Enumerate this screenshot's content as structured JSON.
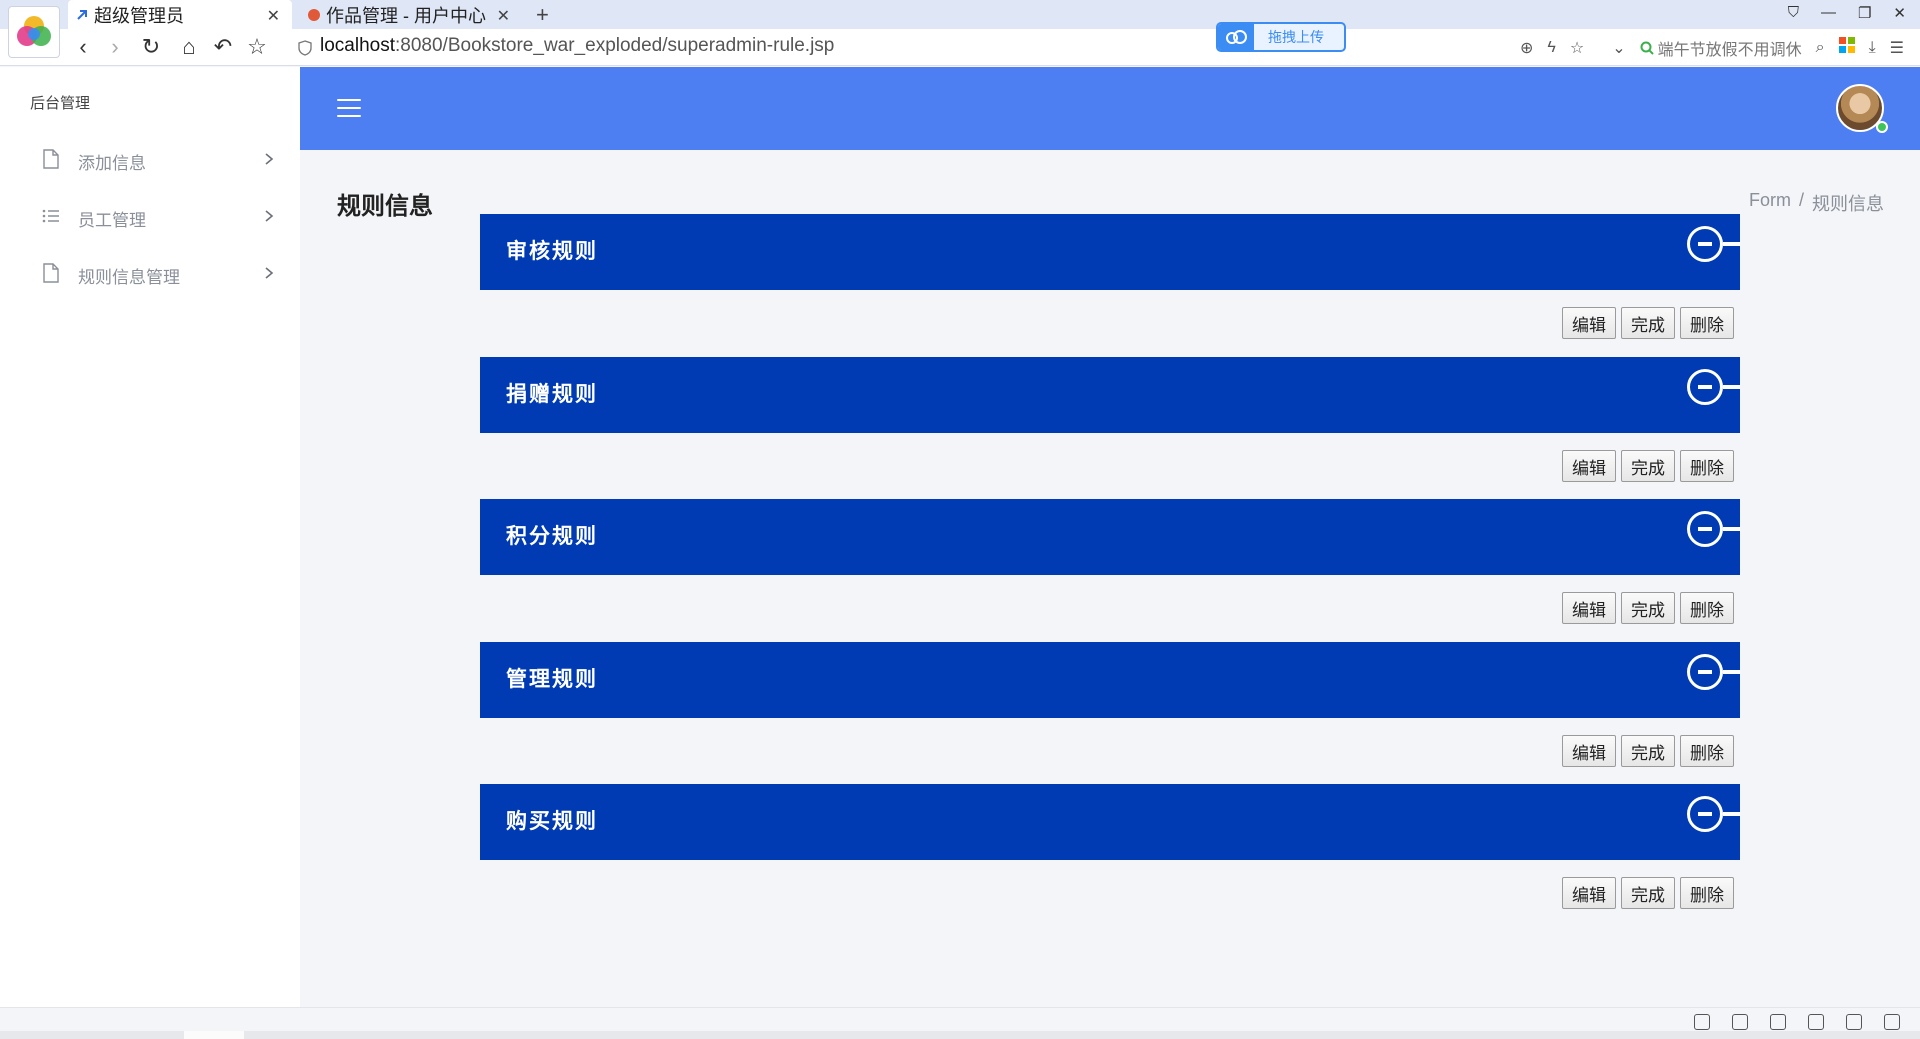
{
  "browser": {
    "tabs": [
      {
        "title": "超级管理员",
        "active": true
      },
      {
        "title": "作品管理 - 用户中心",
        "active": false
      }
    ],
    "url_host": "localhost",
    "url_rest": ":8080/Bookstore_war_exploded/superadmin-rule.jsp",
    "upload_label": "拖拽上传",
    "search_hint": "端午节放假不用调休"
  },
  "sidebar": {
    "title": "后台管理",
    "items": [
      {
        "label": "添加信息",
        "icon": "file-icon"
      },
      {
        "label": "员工管理",
        "icon": "list-icon"
      },
      {
        "label": "规则信息管理",
        "icon": "file-icon"
      }
    ]
  },
  "header": {
    "accent": "#4d7ff2"
  },
  "page": {
    "title": "规则信息",
    "breadcrumb": [
      "Form",
      "规则信息"
    ]
  },
  "rules": {
    "accent": "#003bb3",
    "items": [
      {
        "title": "审核规则"
      },
      {
        "title": "捐赠规则"
      },
      {
        "title": "积分规则"
      },
      {
        "title": "管理规则"
      },
      {
        "title": "购买规则"
      }
    ],
    "actions": {
      "edit": "编辑",
      "done": "完成",
      "delete": "删除"
    }
  }
}
